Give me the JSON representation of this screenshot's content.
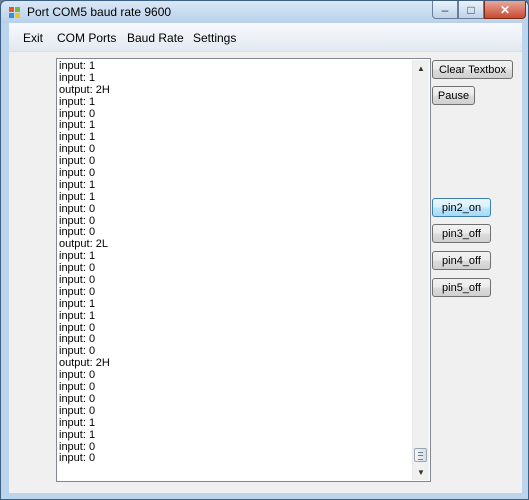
{
  "window": {
    "title": "Port COM5 baud rate 9600",
    "controls": {
      "minimize": "–",
      "maximize": "□",
      "close": "✕"
    }
  },
  "menu": {
    "items": [
      "Exit",
      "COM Ports",
      "Baud Rate",
      "Settings"
    ]
  },
  "textbox": {
    "lines": [
      "input: 1",
      "input: 1",
      "output: 2H",
      "input: 1",
      "input: 0",
      "input: 1",
      "input: 1",
      "input: 0",
      "input: 0",
      "input: 0",
      "input: 1",
      "input: 1",
      "input: 0",
      "input: 0",
      "input: 0",
      "output: 2L",
      "input: 1",
      "input: 0",
      "input: 0",
      "input: 0",
      "input: 1",
      "input: 1",
      "input: 0",
      "input: 0",
      "input: 0",
      "output: 2H",
      "input: 0",
      "input: 0",
      "input: 0",
      "input: 0",
      "input: 1",
      "input: 1",
      "input: 0",
      "input: 0"
    ],
    "scroll_position": 1.0
  },
  "buttons": {
    "clear": "Clear Textbox",
    "pause": "Pause",
    "pin2": "pin2_on",
    "pin3": "pin3_off",
    "pin4": "pin4_off",
    "pin5": "pin5_off"
  },
  "colors": {
    "title_bar": "#c9ddf2",
    "client_bg": "#f0f0f0",
    "close_button": "#c74b33",
    "focused_button": "#bee6fd"
  },
  "icons": {
    "app": "windows-form-icon",
    "scroll_up": "scroll-up-arrow-icon",
    "scroll_down": "scroll-down-arrow-icon"
  }
}
